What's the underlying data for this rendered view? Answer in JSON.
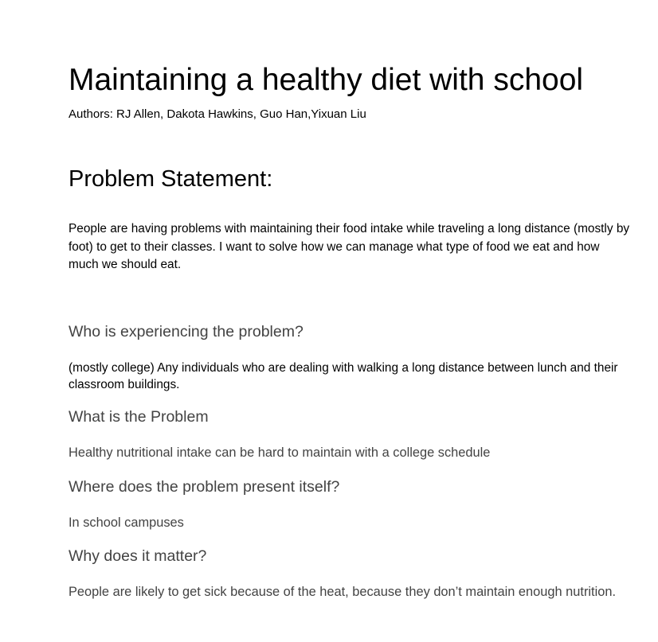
{
  "document": {
    "title": "Maintaining a healthy diet with school",
    "authors": "Authors: RJ Allen,  Dakota Hawkins, Guo Han,Yixuan Liu"
  },
  "problem_statement": {
    "heading": "Problem Statement:",
    "text": "People are having problems with maintaining their food intake while traveling a long distance (mostly by foot) to get to their classes. I want to solve how we can manage what type of food we eat and how much we should eat."
  },
  "sections": [
    {
      "heading": "Who is experiencing the problem?",
      "answer": "(mostly college) Any individuals who are dealing with walking a long distance between lunch and their classroom buildings."
    },
    {
      "heading": "What is the Problem",
      "answer": "Healthy nutritional intake can be hard to maintain with a college schedule"
    },
    {
      "heading": "Where does the problem present itself?",
      "answer": "In school campuses"
    },
    {
      "heading": "Why does it matter?",
      "answer": "People are likely to get sick because of the heat, because they don’t maintain enough nutrition."
    }
  ],
  "colors": {
    "text": "#000000",
    "subheading": "#434343",
    "background": "#ffffff"
  }
}
